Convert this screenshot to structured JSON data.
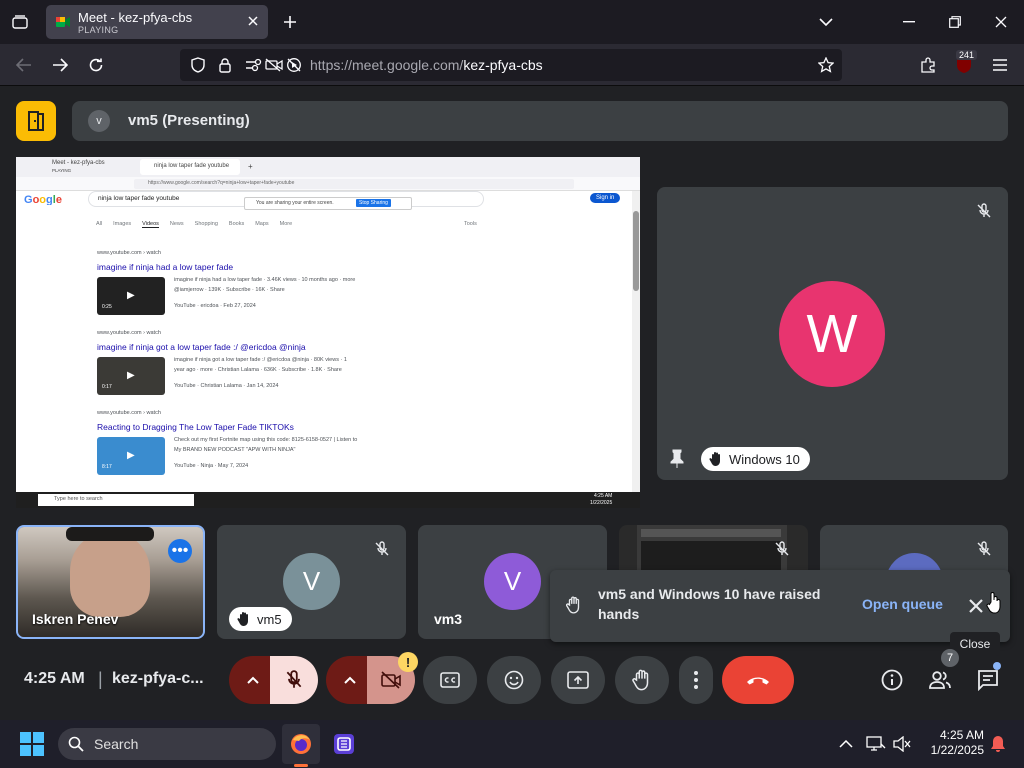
{
  "browser": {
    "tab_title": "Meet - kez-pfya-cbs",
    "tab_status": "PLAYING",
    "url_domain": "https://meet.google.com/",
    "url_path": "kez-pfya-cbs",
    "extension_badge": "241"
  },
  "meet": {
    "presenter_initial": "v",
    "presenter_label": "vm5 (Presenting)",
    "shared_screen": {
      "tab1": "Meet - kez-pfya-cbs",
      "tab1_status": "PLAYING",
      "tab2": "ninja low taper fade youtube",
      "url": "https://www.google.com/search?q=ninja+low+taper+fade+youtube",
      "query": "ninja low taper fade youtube",
      "share_notice": "You are sharing your entire screen.",
      "stop_sharing": "Stop Sharing",
      "filters": [
        "All",
        "Images",
        "Videos",
        "News",
        "Shopping",
        "Books",
        "Maps",
        "More"
      ],
      "tools": "Tools",
      "results": [
        {
          "cite": "www.youtube.com › watch",
          "title": "imagine if ninja had a low taper fade",
          "snippet1": "imagine if ninja had a low taper fade · 3.46K views · 10 months ago · more",
          "snippet2": "@iamjerrow · 139K · Subscribe · 16K · Share",
          "source": "YouTube · ericdoa · Feb 27, 2024",
          "duration": "0:25"
        },
        {
          "cite": "www.youtube.com › watch",
          "title": "imagine if ninja got a low taper fade :/ @ericdoa @ninja",
          "snippet1": "imagine if ninja got a low taper fade :/ @ericdoa @ninja · 80K views · 1",
          "snippet2": "year ago · more · Christian Lalama · 636K · Subscribe · 1.8K · Share",
          "source": "YouTube · Christian Lalama · Jan 14, 2024",
          "duration": "0:17"
        },
        {
          "cite": "www.youtube.com › watch",
          "title": "Reacting to Dragging The Low Taper Fade TIKTOKs",
          "snippet1": "Check out my first Fortnite map using this code: 8125-6158-0527 | Listen to",
          "snippet2": "My BRAND NEW PODCAST \"APW WITH NINJA\"",
          "source": "YouTube · Ninja · May 7, 2024",
          "duration": "8:17"
        }
      ],
      "taskbar_search": "Type here to search",
      "taskbar_time": "4:25 AM",
      "taskbar_date": "1/22/2025"
    },
    "tiles": {
      "windows10": {
        "initial": "W",
        "name": "Windows 10",
        "color": "#e8346f"
      },
      "iskren": {
        "name": "Iskren Penev"
      },
      "vm5": {
        "initial": "V",
        "name": "vm5",
        "color": "#7a9199"
      },
      "vm3": {
        "initial": "V",
        "name": "vm3",
        "color": "#8e5bd8"
      }
    },
    "toast": {
      "message": "vm5 and Windows 10 have raised hands",
      "action": "Open queue",
      "close_tooltip": "Close"
    },
    "bottom": {
      "time": "4:25 AM",
      "separator": "|",
      "meeting_code": "kez-pfya-c...",
      "people_count": "7",
      "warning": "!"
    }
  },
  "taskbar": {
    "search_placeholder": "Search",
    "time": "4:25 AM",
    "date": "1/22/2025"
  },
  "colors": {
    "hangup_red": "#ea4335",
    "accent_blue": "#8ab4f8",
    "meet_bg": "#202124",
    "tile_bg": "#3c4043",
    "home_yellow": "#fbbc04"
  }
}
